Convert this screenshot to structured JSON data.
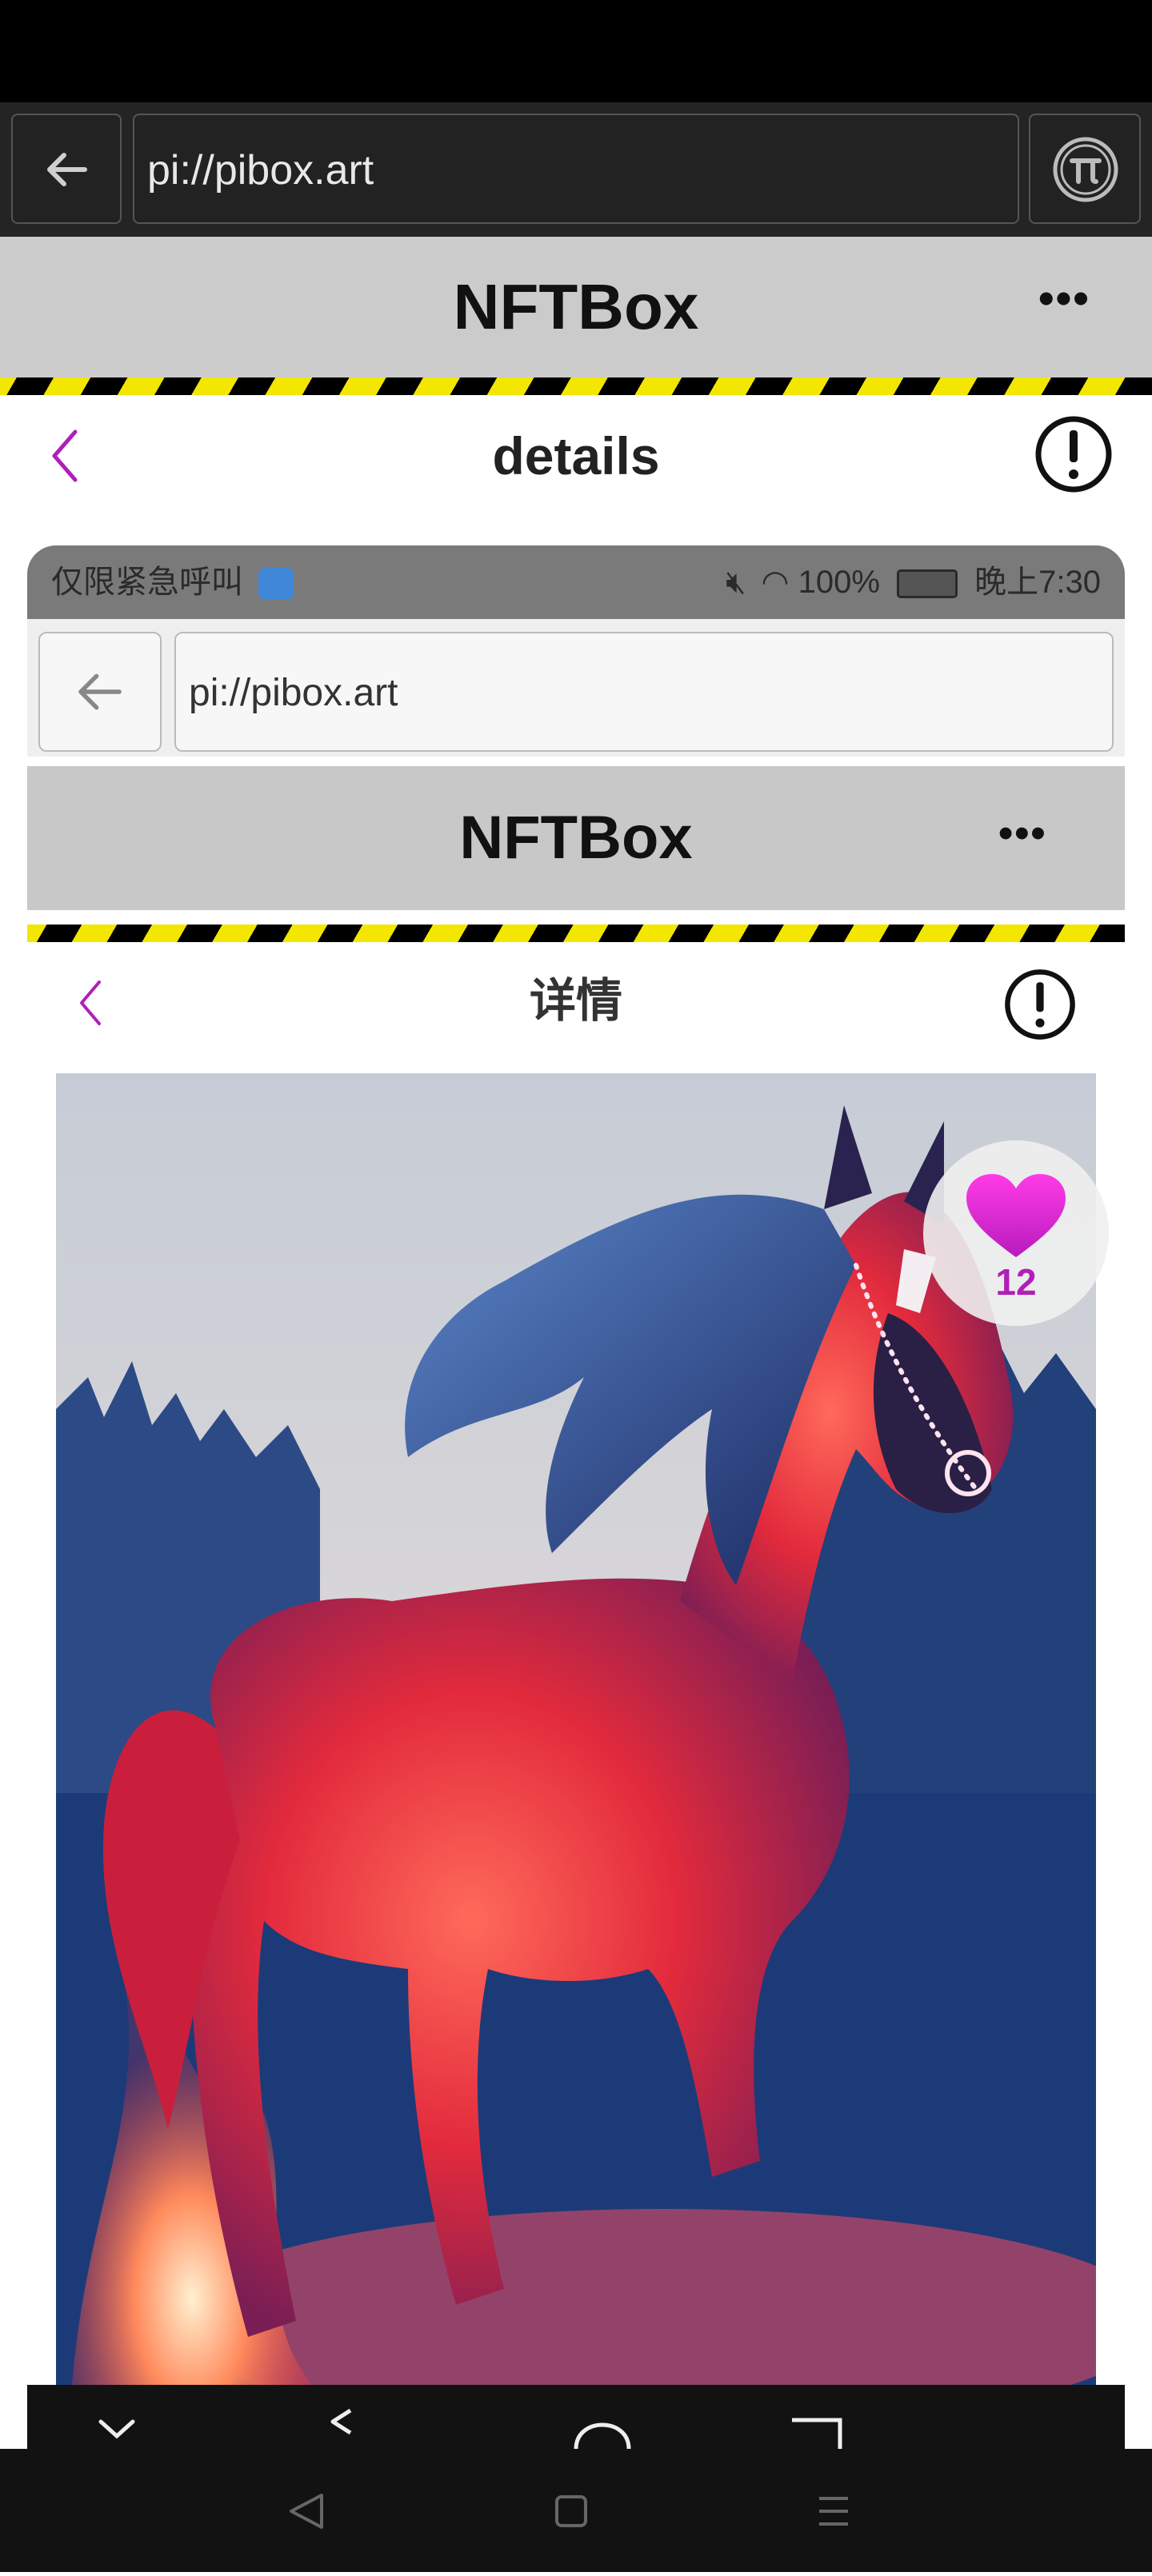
{
  "browser": {
    "url": "pi://pibox.art"
  },
  "app": {
    "title": "NFTBox",
    "menu_glyph": "•••",
    "details_title": "details"
  },
  "inner_screenshot": {
    "status": {
      "left_text": "仅限紧急呼叫",
      "battery": "100%",
      "time": "晚上7:30"
    },
    "url": "pi://pibox.art",
    "app_title": "NFTBox",
    "details_title": "详情",
    "likes": "12"
  },
  "colors": {
    "accent": "#b01fb8",
    "header_gray": "#cbcbcb",
    "hazard_yellow": "#f3e600"
  },
  "icons": [
    "back-arrow-icon",
    "pi-network-icon",
    "more-dots-icon",
    "chevron-left-icon",
    "info-circle-icon",
    "heart-icon",
    "nav-back-icon",
    "nav-home-icon",
    "nav-recents-icon"
  ]
}
